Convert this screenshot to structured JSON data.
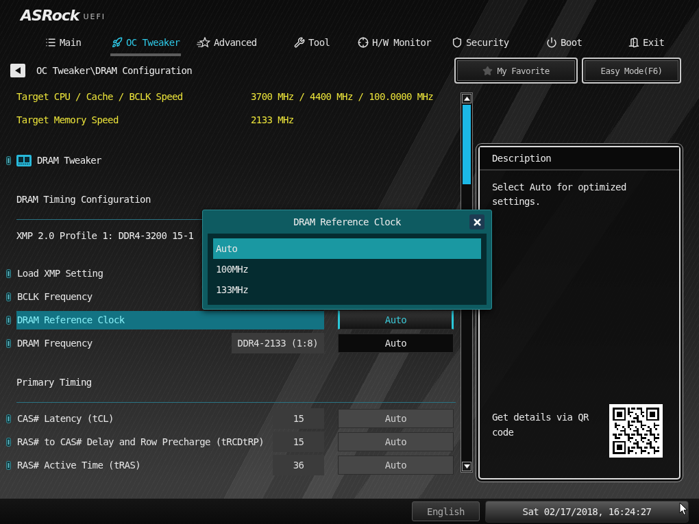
{
  "logo": {
    "brand": "ASRock",
    "product": "UEFI"
  },
  "tabs": [
    {
      "label": "Main",
      "selected": false
    },
    {
      "label": "OC Tweaker",
      "selected": true
    },
    {
      "label": "Advanced",
      "selected": false
    },
    {
      "label": "Tool",
      "selected": false
    },
    {
      "label": "H/W Monitor",
      "selected": false
    },
    {
      "label": "Security",
      "selected": false
    },
    {
      "label": "Boot",
      "selected": false
    },
    {
      "label": "Exit",
      "selected": false
    }
  ],
  "breadcrumb": "OC Tweaker\\DRAM Configuration",
  "toolbar_buttons": [
    {
      "kind": "favorite",
      "label": "My Favorite"
    },
    {
      "kind": "plain",
      "label": "Easy Mode(F6)"
    }
  ],
  "info_rows": [
    {
      "label": "Target CPU / Cache / BCLK Speed",
      "value": "3700 MHz / 4400 MHz / 100.0000 MHz"
    },
    {
      "label": "Target Memory Speed",
      "value": "2133 MHz"
    }
  ],
  "settings": [
    {
      "kind": "submenu",
      "label": "DRAM Tweaker"
    },
    {
      "kind": "section",
      "label": "DRAM Timing Configuration"
    },
    {
      "kind": "note",
      "label": "XMP 2.0 Profile 1: DDR4-3200 15-1"
    },
    {
      "kind": "option",
      "label": "Load XMP Setting",
      "selected": false
    },
    {
      "kind": "option",
      "label": "BCLK Frequency",
      "selected": false
    },
    {
      "kind": "option",
      "label": "DRAM Reference Clock",
      "selected": true,
      "control": {
        "kind": "dropdown",
        "text": "Auto"
      }
    },
    {
      "kind": "option",
      "label": "DRAM Frequency",
      "selected": false,
      "value": "DDR4-2133 (1:8)",
      "control": {
        "kind": "dropdown",
        "text": "Auto"
      }
    },
    {
      "kind": "section",
      "label": "Primary Timing"
    },
    {
      "kind": "option",
      "label": "CAS# Latency (tCL)",
      "selected": false,
      "value": "15",
      "control": {
        "kind": "field",
        "text": "Auto"
      }
    },
    {
      "kind": "option",
      "label": "RAS# to CAS# Delay and Row Precharge (tRCDtRP)",
      "selected": false,
      "value": "15",
      "control": {
        "kind": "field",
        "text": "Auto"
      }
    },
    {
      "kind": "option",
      "label": "RAS# Active Time (tRAS)",
      "selected": false,
      "value": "36",
      "control": {
        "kind": "field",
        "text": "Auto"
      }
    }
  ],
  "popup": {
    "title": "DRAM Reference Clock",
    "options": [
      {
        "label": "Auto",
        "selected": true
      },
      {
        "label": "100MHz",
        "selected": false
      },
      {
        "label": "133MHz",
        "selected": false
      }
    ]
  },
  "description": {
    "title": "Description",
    "text": "Select Auto for optimized settings.",
    "qr_caption": "Get details via QR code"
  },
  "status_bar": {
    "language": "English",
    "datetime": "Sat 02/17/2018, 16:24:27"
  }
}
